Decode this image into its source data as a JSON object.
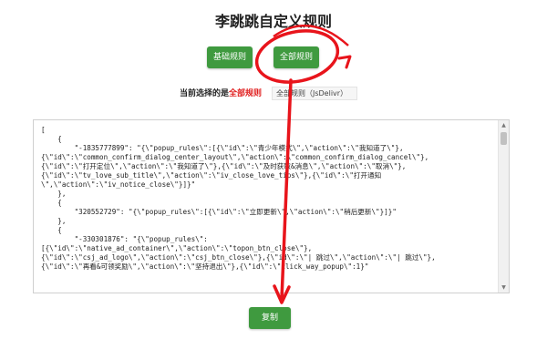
{
  "page": {
    "title": "李跳跳自定义规则"
  },
  "buttons": {
    "basic_rules": "基础规则",
    "all_rules": "全部规则",
    "copy": "复制"
  },
  "selection": {
    "prefix": "当前选择的是",
    "current": "全部规则",
    "source": "全部规则（JsDelivr）"
  },
  "code": {
    "lines": [
      "[",
      "    {",
      "        \"-1835777899\": \"{\\\"popup_rules\\\":[{\\\"id\\\":\\\"青少年模式\\\",\\\"action\\\":\\\"我知道了\\\"},",
      "{\\\"id\\\":\\\"common_confirm_dialog_center_layout\\\",\\\"action\\\":\\\"common_confirm_dialog_cancel\\\"},",
      "{\\\"id\\\":\\\"打开定位\\\",\\\"action\\\":\\\"我知道了\\\"},{\\\"id\\\":\\\"及时获取&消息\\\",\\\"action\\\":\\\"取消\\\"},",
      "{\\\"id\\\":\\\"tv_love_sub_title\\\",\\\"action\\\":\\\"iv_close_love_tips\\\"},{\\\"id\\\":\\\"打开通知",
      "\\\",\\\"action\\\":\\\"iv_notice_close\\\"}]}\"",
      "    },",
      "    {",
      "        \"320552729\": \"{\\\"popup_rules\\\":[{\\\"id\\\":\\\"立即更新\\\",\\\"action\\\":\\\"稍后更新\\\"}]}\"",
      "    },",
      "    {",
      "        \"-330301876\": \"{\\\"popup_rules\\\":",
      "[{\\\"id\\\":\\\"native_ad_container\\\",\\\"action\\\":\\\"topon_btn_close\\\"},",
      "{\\\"id\\\":\\\"csj_ad_logo\\\",\\\"action\\\":\\\"csj_btn_close\\\"},{\\\"id\\\":\\\"| 跳过\\\",\\\"action\\\":\\\"| 跳过\\\"},",
      "{\\\"id\\\":\\\"再看&可领奖励\\\",\\\"action\\\":\\\"坚持退出\\\"},{\\\"id\\\":\\\"click_way_popup\\\":1}\""
    ]
  },
  "colors": {
    "button_green": "#3f9a3f",
    "highlight_red": "#e02020",
    "annotation_red": "#e8141b"
  }
}
